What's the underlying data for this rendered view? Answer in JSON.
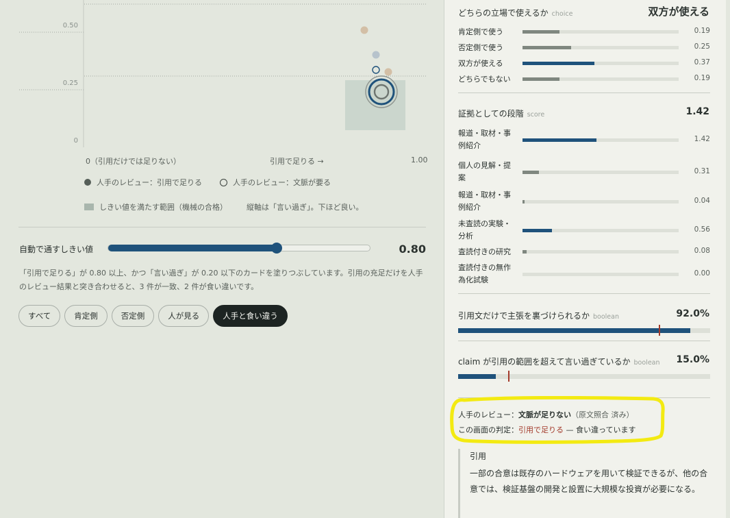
{
  "scatter": {
    "y_ticks": [
      "0.50",
      "0.25",
      "0"
    ],
    "x_ticks": {
      "left": "0（引用だけでは足りない）",
      "center": "引用で足りる →",
      "right": "1.00"
    },
    "legend": {
      "human_sufficient": "人手のレビュー：引用で足りる",
      "human_context": "人手のレビュー：文脈が要る",
      "pass_region": "しきい値を満たす範囲（機械の合格）",
      "axis_note": "縦軸は「言い過ぎ」。下ほど良い。"
    },
    "colors": {
      "pass_region": "#cbd6cd",
      "tan": "#d3bfa6",
      "blue_light": "#b7c3cc",
      "blue_dark": "#1f527b",
      "grey_ring": "#8e948f"
    }
  },
  "threshold": {
    "label": "自動で通すしきい値",
    "value": 0.8,
    "value_text": "0.80",
    "description": "「引用で足りる」が 0.80 以上、かつ「言い過ぎ」が 0.20 以下のカードを塗りつぶしています。引用の充足だけを人手のレビュー結果と突き合わせると、3 件が一致、2 件が食い違いです。"
  },
  "filters": [
    {
      "label": "すべて",
      "active": false
    },
    {
      "label": "肯定側",
      "active": false
    },
    {
      "label": "否定側",
      "active": false
    },
    {
      "label": "人が見る",
      "active": false
    },
    {
      "label": "人手と食い違う",
      "active": true
    }
  ],
  "stance": {
    "title": "どちらの立場で使えるか",
    "type": "choice",
    "value": "双方が使える",
    "bars": [
      {
        "label": "肯定側で使う",
        "value": 0.19,
        "value_text": "0.19",
        "highlight": false
      },
      {
        "label": "否定側で使う",
        "value": 0.25,
        "value_text": "0.25",
        "highlight": false
      },
      {
        "label": "双方が使える",
        "value": 0.37,
        "value_text": "0.37",
        "highlight": true
      },
      {
        "label": "どちらでもない",
        "value": 0.19,
        "value_text": "0.19",
        "highlight": false
      }
    ]
  },
  "evidence": {
    "title": "証拠としての段階",
    "type": "score",
    "value": "1.42",
    "bars": [
      {
        "label": "報道・取材・事例紹介",
        "value": 1.42,
        "value_text": "1.42",
        "highlight": true
      },
      {
        "label": "個人の見解・提案",
        "value": 0.31,
        "value_text": "0.31",
        "highlight": false
      },
      {
        "label": "報道・取材・事例紹介",
        "value": 0.04,
        "value_text": "0.04",
        "highlight": false
      },
      {
        "label": "未査読の実験・分析",
        "value": 0.56,
        "value_text": "0.56",
        "highlight": true
      },
      {
        "label": "査読付きの研究",
        "value": 0.08,
        "value_text": "0.08",
        "highlight": false
      },
      {
        "label": "査読付きの無作為化試験",
        "value": 0.0,
        "value_text": "0.00",
        "highlight": false
      }
    ]
  },
  "quote_support": {
    "title": "引用文だけで主張を裏づけられるか",
    "type": "boolean",
    "value_text": "92.0%",
    "value": 0.92,
    "threshold": 0.8
  },
  "overclaim": {
    "title": "claim が引用の範囲を超えて言い過ぎているか",
    "type": "boolean",
    "value_text": "15.0%",
    "value": 0.15,
    "threshold": 0.2
  },
  "review": {
    "human_prefix": "人手のレビュー：",
    "human_value": "文脈が足りない",
    "human_suffix": "（原文照合 済み）",
    "screen_prefix": "この画面の判定：",
    "screen_value": "引用で足りる",
    "screen_suffix": " — 食い違っています"
  },
  "quote": {
    "heading": "引用",
    "text": "一部の合意は既存のハードウェアを用いて検証できるが、他の合意では、検証基盤の開発と設置に大規模な投資が必要になる。"
  },
  "colors": {
    "accent": "#1f527b",
    "bar_grey": "#7f877f",
    "mismatch_red": "#a33a2b",
    "highlight_yellow": "#f3ea12",
    "active_chip": "#1d2422"
  }
}
